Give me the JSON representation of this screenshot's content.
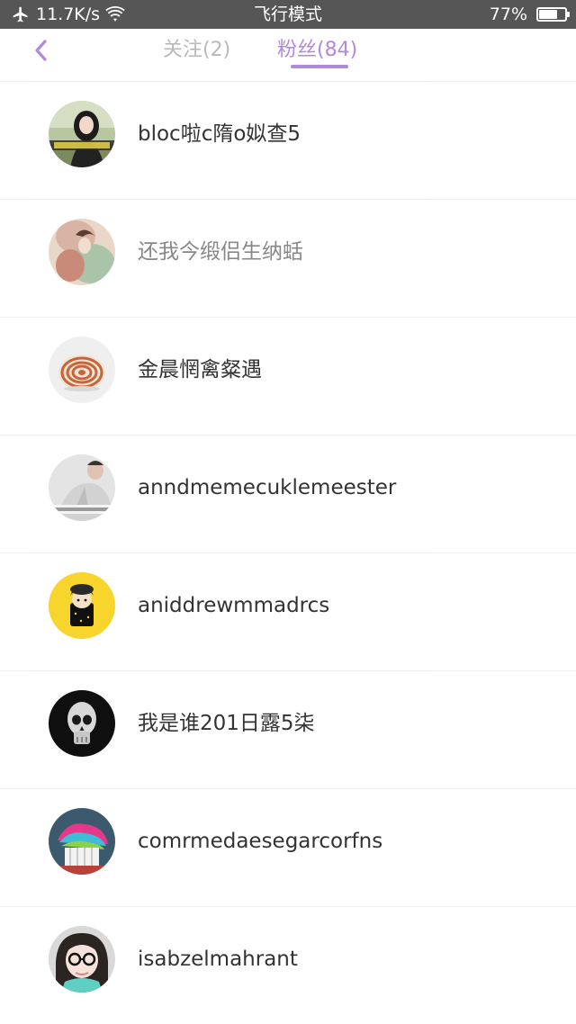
{
  "status_bar": {
    "network_speed": "11.7K/s",
    "mode": "飞行模式",
    "battery_percent": "77%",
    "battery_level": 0.77,
    "icons": [
      "airplane-icon",
      "wifi-icon",
      "battery-icon"
    ]
  },
  "nav": {
    "back_icon": "chevron-left-icon",
    "tabs": [
      {
        "label": "关注(2)",
        "active": false
      },
      {
        "label": "粉丝(84)",
        "active": true
      }
    ],
    "accent_color": "#b38ad9"
  },
  "fans": [
    {
      "name": "bloc啦c隋o姒查5",
      "avatar": "avatar-photo-woman"
    },
    {
      "name": "还我今缎侣生纳蛞",
      "avatar": "avatar-painting"
    },
    {
      "name": "金晨惘禽粲遇",
      "avatar": "avatar-shell"
    },
    {
      "name": "anndmemecuklemeester",
      "avatar": "avatar-photo-man"
    },
    {
      "name": "aniddrewmmadrcs",
      "avatar": "avatar-cartoon"
    },
    {
      "name": "我是谁201日露5柒",
      "avatar": "avatar-skull"
    },
    {
      "name": "comrmedaesegarcorfns",
      "avatar": "avatar-cupcake"
    },
    {
      "name": "isabzelmahrant",
      "avatar": "avatar-glasses-girl"
    }
  ]
}
